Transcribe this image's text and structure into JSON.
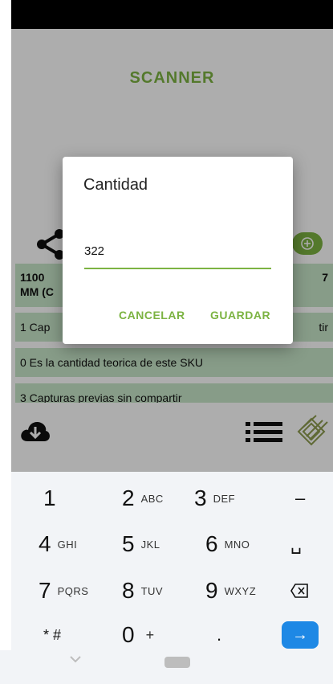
{
  "app": {
    "title": "SCANNER"
  },
  "product": {
    "left": "1100",
    "left2": "MM (C",
    "right": "7"
  },
  "rows": [
    "1 Cap",
    "0 Es la cantidad teorica de este SKU",
    "3 Capturas previas sin compartir"
  ],
  "row1_right": "tir",
  "dialog": {
    "title": "Cantidad",
    "value": "322",
    "cancel": "CANCELAR",
    "save": "GUARDAR"
  },
  "keyboard": {
    "k1": "1",
    "k2": "2",
    "k2l": "ABC",
    "k3": "3",
    "k3l": "DEF",
    "kminus": "–",
    "k4": "4",
    "k4l": "GHI",
    "k5": "5",
    "k5l": "JKL",
    "k6": "6",
    "k6l": "MNO",
    "kspace": "␣",
    "k7": "7",
    "k7l": "PQRS",
    "k8": "8",
    "k8l": "TUV",
    "k9": "9",
    "k9l": "WXYZ",
    "kstar": "* #",
    "k0": "0",
    "k0l": "+",
    "kdot": ".",
    "kenter": "→"
  },
  "colors": {
    "accent": "#7cb342",
    "row_bg": "#c8e6c9",
    "enter": "#1e88e5"
  },
  "icons": [
    "share-icon",
    "plus-circle-icon",
    "cloud-download-icon",
    "list-icon",
    "logo-icon",
    "backspace-icon",
    "arrow-right-icon",
    "chevron-down-icon"
  ]
}
